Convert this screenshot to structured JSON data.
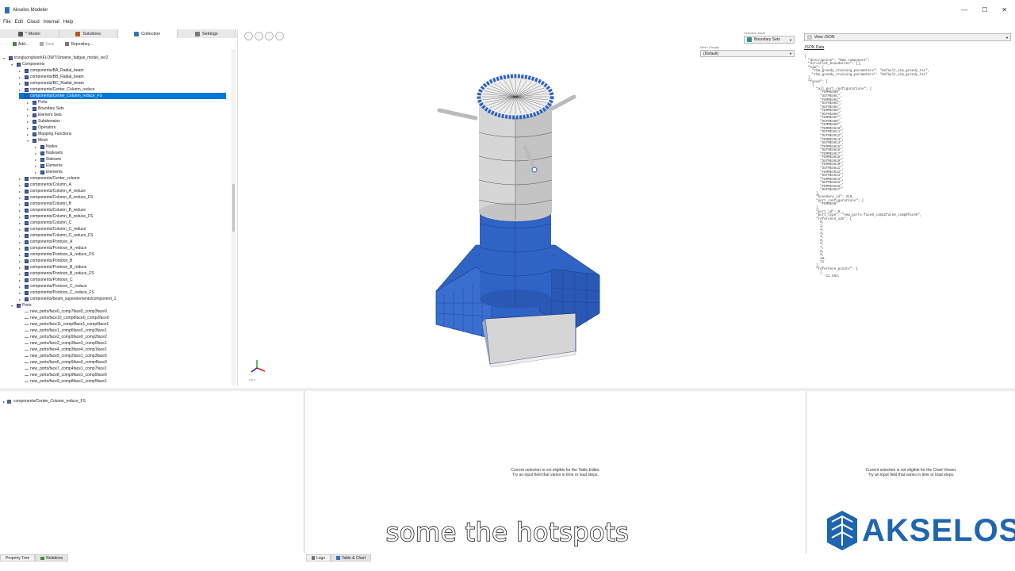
{
  "window": {
    "title": "Akselos Modeler",
    "controls": [
      "—",
      "☐",
      "✕"
    ]
  },
  "menu": [
    "File",
    "Edit",
    "Cloud",
    "Internal",
    "Help"
  ],
  "tabs": [
    {
      "label": "* Model",
      "icon": "model-icon",
      "color": "#555555"
    },
    {
      "label": "Solutions",
      "icon": "solutions-icon",
      "color": "#b35a1f"
    },
    {
      "label": "Collection",
      "icon": "collection-icon",
      "color": "#3a6fb0"
    },
    {
      "label": "Settings",
      "icon": "settings-icon",
      "color": "#777777"
    }
  ],
  "toolbar": {
    "add": "Add...",
    "save": "Save",
    "repository": "Repository..."
  },
  "tree": [
    {
      "label": "trongluong/workFLOWT/Umaine_fatigue_model_ver2",
      "depth": 0,
      "arrow": "▾",
      "kind": "box"
    },
    {
      "label": "Components",
      "depth": 1,
      "arrow": "▾",
      "kind": "box"
    },
    {
      "label": "components/BA_Radial_beam",
      "depth": 2,
      "arrow": "▸",
      "kind": "box"
    },
    {
      "label": "components/BB_Radial_beam",
      "depth": 2,
      "arrow": "▸",
      "kind": "box"
    },
    {
      "label": "components/BC_Radial_beam",
      "depth": 2,
      "arrow": "▸",
      "kind": "box"
    },
    {
      "label": "components/Center_Column_reduce",
      "depth": 2,
      "arrow": "▸",
      "kind": "box"
    },
    {
      "label": "components/Center_Column_reduce_FS",
      "depth": 2,
      "arrow": "▾",
      "kind": "box",
      "selected": true
    },
    {
      "label": "Ports",
      "depth": 3,
      "arrow": "▸",
      "kind": "box"
    },
    {
      "label": "Boundary Sets",
      "depth": 3,
      "arrow": "▸",
      "kind": "box"
    },
    {
      "label": "Element Sets",
      "depth": 3,
      "arrow": "▸",
      "kind": "box"
    },
    {
      "label": "Subdomains",
      "depth": 3,
      "arrow": "▸",
      "kind": "box"
    },
    {
      "label": "Operators",
      "depth": 3,
      "arrow": "▸",
      "kind": "box"
    },
    {
      "label": "Mapping Functions",
      "depth": 3,
      "arrow": "▸",
      "kind": "box"
    },
    {
      "label": "Mesh",
      "depth": 3,
      "arrow": "▾",
      "kind": "box"
    },
    {
      "label": "Nodes",
      "depth": 4,
      "arrow": "▸",
      "kind": "box"
    },
    {
      "label": "Nodesets",
      "depth": 4,
      "arrow": "▸",
      "kind": "box"
    },
    {
      "label": "Sidesets",
      "depth": 4,
      "arrow": "▸",
      "kind": "box"
    },
    {
      "label": "Elements",
      "depth": 4,
      "arrow": "▸",
      "kind": "box"
    },
    {
      "label": "Elements",
      "depth": 4,
      "arrow": "▸",
      "kind": "box"
    },
    {
      "label": "components/Center_column",
      "depth": 2,
      "arrow": "▸",
      "kind": "box"
    },
    {
      "label": "components/Column_A",
      "depth": 2,
      "arrow": "▸",
      "kind": "box"
    },
    {
      "label": "components/Column_A_reduce",
      "depth": 2,
      "arrow": "▸",
      "kind": "box"
    },
    {
      "label": "components/Column_A_reduce_FS",
      "depth": 2,
      "arrow": "▸",
      "kind": "box"
    },
    {
      "label": "components/Column_B",
      "depth": 2,
      "arrow": "▸",
      "kind": "box"
    },
    {
      "label": "components/Column_B_reduce",
      "depth": 2,
      "arrow": "▸",
      "kind": "box"
    },
    {
      "label": "components/Column_B_reduce_FS",
      "depth": 2,
      "arrow": "▸",
      "kind": "box"
    },
    {
      "label": "components/Column_C",
      "depth": 2,
      "arrow": "▸",
      "kind": "box"
    },
    {
      "label": "components/Column_C_reduce",
      "depth": 2,
      "arrow": "▸",
      "kind": "box"
    },
    {
      "label": "components/Column_C_reduce_FS",
      "depth": 2,
      "arrow": "▸",
      "kind": "box"
    },
    {
      "label": "components/Pontoon_A",
      "depth": 2,
      "arrow": "▸",
      "kind": "box"
    },
    {
      "label": "components/Pontoon_A_reduce",
      "depth": 2,
      "arrow": "▸",
      "kind": "box"
    },
    {
      "label": "components/Pontoon_A_reduce_FS",
      "depth": 2,
      "arrow": "▸",
      "kind": "box"
    },
    {
      "label": "components/Pontoon_B",
      "depth": 2,
      "arrow": "▸",
      "kind": "box"
    },
    {
      "label": "components/Pontoon_B_reduce",
      "depth": 2,
      "arrow": "▸",
      "kind": "box"
    },
    {
      "label": "components/Pontoon_B_reduce_FS",
      "depth": 2,
      "arrow": "▸",
      "kind": "box"
    },
    {
      "label": "components/Pontoon_C",
      "depth": 2,
      "arrow": "▸",
      "kind": "box"
    },
    {
      "label": "components/Pontoon_C_reduce",
      "depth": 2,
      "arrow": "▸",
      "kind": "box"
    },
    {
      "label": "components/Pontoon_C_reduce_FS",
      "depth": 2,
      "arrow": "▸",
      "kind": "box"
    },
    {
      "label": "components/beam_superelements/component_1",
      "depth": 2,
      "arrow": "▸",
      "kind": "box"
    },
    {
      "label": "Ports",
      "depth": 1,
      "arrow": "▾",
      "kind": "box"
    },
    {
      "label": "new_ports/face0_comp7face0_comp3face0",
      "depth": 2,
      "arrow": "",
      "kind": "port"
    },
    {
      "label": "new_ports/face10_comp6face0_comp2face0",
      "depth": 2,
      "arrow": "",
      "kind": "port"
    },
    {
      "label": "new_ports/face11_comp9face1_comp6face1",
      "depth": 2,
      "arrow": "",
      "kind": "port"
    },
    {
      "label": "new_ports/face1_comp6face0_comp3face1",
      "depth": 2,
      "arrow": "",
      "kind": "port"
    },
    {
      "label": "new_ports/face2_comp9face0_comp2face2",
      "depth": 2,
      "arrow": "",
      "kind": "port"
    },
    {
      "label": "new_ports/face3_comp3face3_comp0face1",
      "depth": 2,
      "arrow": "",
      "kind": "port"
    },
    {
      "label": "new_ports/face4_comp3face4_comp1face1",
      "depth": 2,
      "arrow": "",
      "kind": "port"
    },
    {
      "label": "new_ports/face5_comp2face1_comp3face5",
      "depth": 2,
      "arrow": "",
      "kind": "port"
    },
    {
      "label": "new_ports/face6_comp9face0_comp4face0",
      "depth": 2,
      "arrow": "",
      "kind": "port"
    },
    {
      "label": "new_ports/face7_comp4face1_comp7face1",
      "depth": 2,
      "arrow": "",
      "kind": "port"
    },
    {
      "label": "new_ports/face8_comp9face1_comp5face0",
      "depth": 2,
      "arrow": "",
      "kind": "port"
    },
    {
      "label": "new_ports/face9_comp8face1_comp5face1",
      "depth": 2,
      "arrow": "",
      "kind": "port"
    }
  ],
  "viewport": {
    "selection_mode_label": "Selection Mode",
    "selection_mode_value": "Boundary Sets",
    "mesh_display_label": "Mesh Display",
    "mesh_display_value": "(Default)",
    "axis_label": "x y z"
  },
  "right_panel": {
    "view_select": "View JSON",
    "heading": "JSON Data",
    "json_text": "{\n  \"description\": \"New component\",\n  \"dirichlet_boundaries\": [],\n  \"eim\": {\n    \"rbm_greedy_training_parameters\": \"default_eim_greedy_tss\",\n    \"rbm_greedy_training_parameters\": \"default_eim_greedy_tss\"\n  },\n  \"faces\": [\n    {\n      \"all_port_configurations\": [\n        \"FEMMESH0\",\n        \"OUTMESH1\",\n        \"FEMMESH2\",\n        \"OUTMESH3\",\n        \"OUTMESH4\",\n        \"FEMMESH5\",\n        \"OUTMESH6\",\n        \"FEMMESH7\",\n        \"OUTMESH8\",\n        \"FEMMESH9\",\n        \"FEMMESH10\",\n        \"OUTMESH11\",\n        \"OUTMESH12\",\n        \"FEMMESH13\",\n        \"OUTMESH14\",\n        \"FEMMESH15\",\n        \"OUTMESH16\",\n        \"FEMMESH17\",\n        \"FEMMESH18\",\n        \"OUTMESH19\",\n        \"FEMMESH20\",\n        \"OUTMESH21\",\n        \"FEMMESH22\",\n        \"OUTMESH23\",\n        \"FEMMESH24\",\n        \"OUTMESH25\",\n        \"FEMMESH26\",\n        \"OUTMESH27\"\n      ],\n      \"boundary_id\": 210,\n      \"port_configurations\": [\n        \"FEMMESH\"\n      ],\n      \"port_id\": 0,\n      \"port_type\": \"new_ports:face0_comp2face0_comp0face0\",\n      \"reference_ids\": [\n        0,\n        1,\n        2,\n        3,\n        4,\n        5,\n        6,\n        7,\n        8,\n        9,\n        10,\n        11\n      ],\n      \"reference_points\": [\n        [\n          -11.594,"
  },
  "bottom": {
    "tree_item": "components/Center_Column_reduce_FS",
    "table_msg_1": "Current selection is not eligible for the Table Editor.",
    "table_msg_2": "Try an input field that varies in time or load steps.",
    "chart_msg_1": "Current selection is not eligible for the Chart Viewer.",
    "chart_msg_2": "Try an input field that varies in time or load steps.",
    "tabs_left": [
      "Property Tree",
      "Relations"
    ],
    "tabs_mid": [
      "Logs",
      "Table & Chart"
    ]
  },
  "caption": "some the hotspots",
  "logo": {
    "word": "AKSELOS",
    "color": "#1f65b0"
  },
  "colors": {
    "accent": "#0078d7",
    "mesh_blue": "#2f63c4",
    "mesh_grey": "#d3d3d3"
  }
}
